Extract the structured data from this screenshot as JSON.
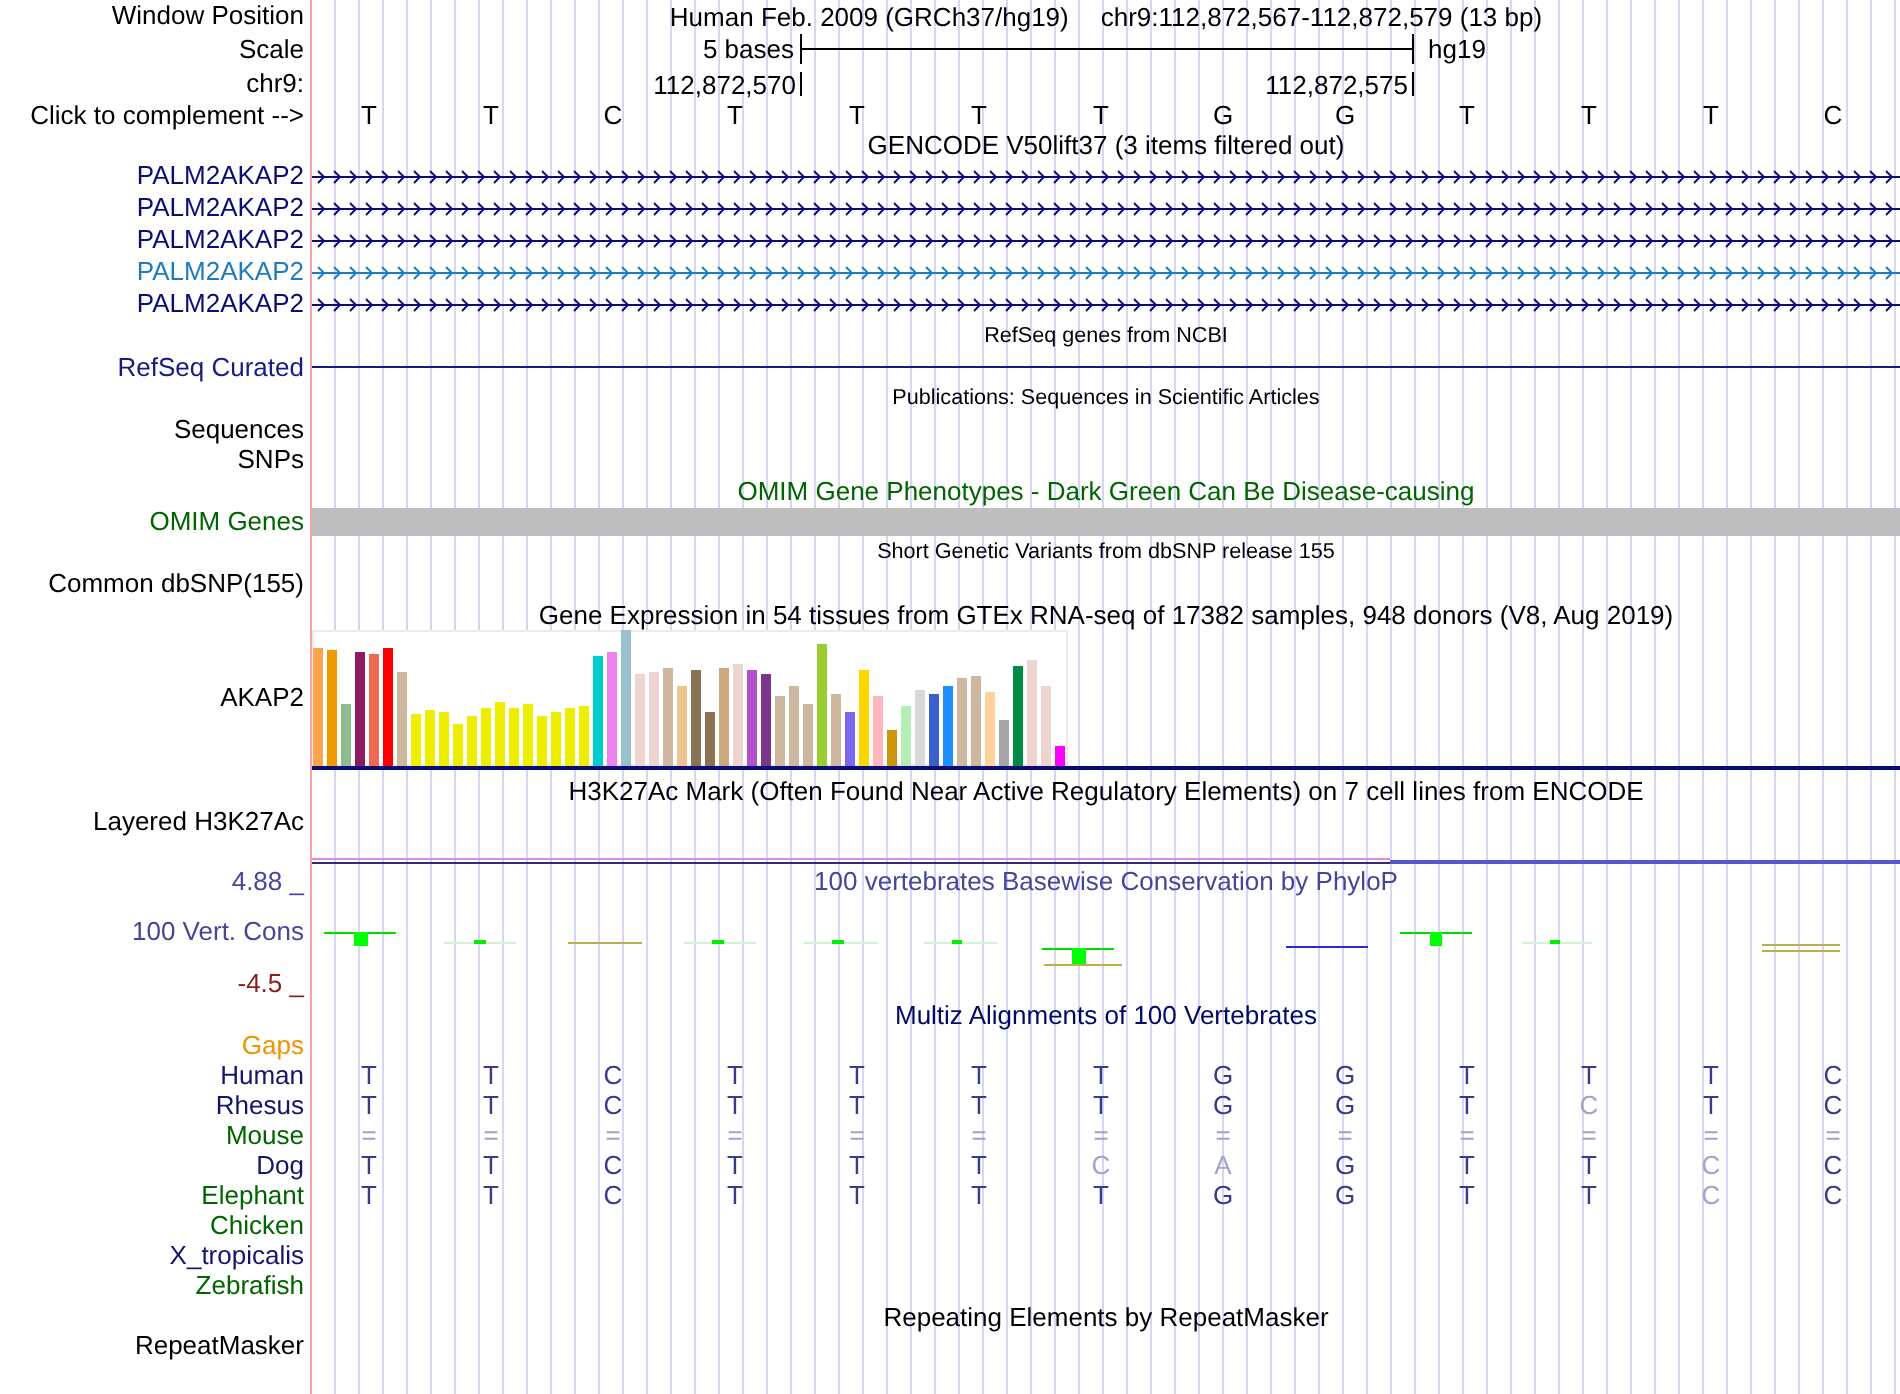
{
  "position": {
    "label": "Window Position",
    "assembly": "Human Feb. 2009 (GRCh37/hg19)",
    "range": "chr9:112,872,567-112,872,579 (13 bp)"
  },
  "scale": {
    "label": "Scale",
    "length": "5 bases",
    "database": "hg19"
  },
  "coordinates": {
    "label": "chr9:",
    "ticks": [
      "112,872,570",
      "112,872,575"
    ]
  },
  "sequence": {
    "label": "Click to complement -->",
    "bases": [
      "T",
      "T",
      "C",
      "T",
      "T",
      "T",
      "T",
      "G",
      "G",
      "T",
      "T",
      "T",
      "C"
    ]
  },
  "tracks": [
    {
      "kind": "genes",
      "title": "GENCODE V50lift37 (3 items filtered out)",
      "items": [
        {
          "label": "PALM2AKAP2",
          "color": "#0c0c78"
        },
        {
          "label": "PALM2AKAP2",
          "color": "#0c0c78"
        },
        {
          "label": "PALM2AKAP2",
          "color": "#0c0c78"
        },
        {
          "label": "PALM2AKAP2",
          "color": "#1f7bbf"
        },
        {
          "label": "PALM2AKAP2",
          "color": "#0c0c78"
        }
      ]
    },
    {
      "kind": "line",
      "title": "RefSeq genes from NCBI",
      "labels": [
        "RefSeq Curated"
      ]
    },
    {
      "kind": "empty",
      "title": "Publications: Sequences in Scientific Articles",
      "labels": [
        "Sequences",
        "SNPs"
      ]
    },
    {
      "kind": "bar",
      "title": "OMIM Gene Phenotypes - Dark Green Can Be Disease-causing",
      "labels": [
        "OMIM Genes"
      ]
    },
    {
      "kind": "empty",
      "title": "Short Genetic Variants from dbSNP release 155",
      "labels": [
        "Common dbSNP(155)"
      ]
    },
    {
      "kind": "expression",
      "title": "Gene Expression in 54 tissues from GTEx RNA-seq of 17382 samples, 948 donors (V8, Aug 2019)",
      "labels": [
        "AKAP2"
      ]
    },
    {
      "kind": "signal",
      "title": "H3K27Ac Mark (Often Found Near Active Regulatory Elements) on 7 cell lines from ENCODE",
      "labels": [
        "Layered H3K27Ac"
      ]
    },
    {
      "kind": "conservation",
      "title": "100 vertebrates Basewise Conservation by PhyloP",
      "labels": [
        "100 Vert. Cons"
      ],
      "max": "4.88 _",
      "min": "-4.5 _"
    },
    {
      "kind": "alignment",
      "title": "Multiz Alignments of 100 Vertebrates",
      "gaps": "Gaps",
      "species": [
        {
          "name": "Human",
          "color": "#14146e",
          "bases": [
            {
              "base": "T",
              "dimmed": false
            },
            {
              "base": "T",
              "dimmed": false
            },
            {
              "base": "C",
              "dimmed": false
            },
            {
              "base": "T",
              "dimmed": false
            },
            {
              "base": "T",
              "dimmed": false
            },
            {
              "base": "T",
              "dimmed": false
            },
            {
              "base": "T",
              "dimmed": false
            },
            {
              "base": "G",
              "dimmed": false
            },
            {
              "base": "G",
              "dimmed": false
            },
            {
              "base": "T",
              "dimmed": false
            },
            {
              "base": "T",
              "dimmed": false
            },
            {
              "base": "T",
              "dimmed": false
            },
            {
              "base": "C",
              "dimmed": false
            }
          ]
        },
        {
          "name": "Rhesus",
          "color": "#14146e",
          "bases": [
            {
              "base": "T",
              "dimmed": false
            },
            {
              "base": "T",
              "dimmed": false
            },
            {
              "base": "C",
              "dimmed": false
            },
            {
              "base": "T",
              "dimmed": false
            },
            {
              "base": "T",
              "dimmed": false
            },
            {
              "base": "T",
              "dimmed": false
            },
            {
              "base": "T",
              "dimmed": false
            },
            {
              "base": "G",
              "dimmed": false
            },
            {
              "base": "G",
              "dimmed": false
            },
            {
              "base": "T",
              "dimmed": false
            },
            {
              "base": "C",
              "dimmed": true
            },
            {
              "base": "T",
              "dimmed": false
            },
            {
              "base": "C",
              "dimmed": false
            }
          ]
        },
        {
          "name": "Mouse",
          "color": "#006400",
          "bases": [
            {
              "base": "=",
              "dimmed": true
            },
            {
              "base": "=",
              "dimmed": true
            },
            {
              "base": "=",
              "dimmed": true
            },
            {
              "base": "=",
              "dimmed": true
            },
            {
              "base": "=",
              "dimmed": true
            },
            {
              "base": "=",
              "dimmed": true
            },
            {
              "base": "=",
              "dimmed": true
            },
            {
              "base": "=",
              "dimmed": true
            },
            {
              "base": "=",
              "dimmed": true
            },
            {
              "base": "=",
              "dimmed": true
            },
            {
              "base": "=",
              "dimmed": true
            },
            {
              "base": "=",
              "dimmed": true
            },
            {
              "base": "=",
              "dimmed": true
            }
          ]
        },
        {
          "name": "Dog",
          "color": "#14146e",
          "bases": [
            {
              "base": "T",
              "dimmed": false
            },
            {
              "base": "T",
              "dimmed": false
            },
            {
              "base": "C",
              "dimmed": false
            },
            {
              "base": "T",
              "dimmed": false
            },
            {
              "base": "T",
              "dimmed": false
            },
            {
              "base": "T",
              "dimmed": false
            },
            {
              "base": "C",
              "dimmed": true
            },
            {
              "base": "A",
              "dimmed": true
            },
            {
              "base": "G",
              "dimmed": false
            },
            {
              "base": "T",
              "dimmed": false
            },
            {
              "base": "T",
              "dimmed": false
            },
            {
              "base": "C",
              "dimmed": true
            },
            {
              "base": "C",
              "dimmed": false
            }
          ]
        },
        {
          "name": "Elephant",
          "color": "#006400",
          "bases": [
            {
              "base": "T",
              "dimmed": false
            },
            {
              "base": "T",
              "dimmed": false
            },
            {
              "base": "C",
              "dimmed": false
            },
            {
              "base": "T",
              "dimmed": false
            },
            {
              "base": "T",
              "dimmed": false
            },
            {
              "base": "T",
              "dimmed": false
            },
            {
              "base": "T",
              "dimmed": false
            },
            {
              "base": "G",
              "dimmed": false
            },
            {
              "base": "G",
              "dimmed": false
            },
            {
              "base": "T",
              "dimmed": false
            },
            {
              "base": "T",
              "dimmed": false
            },
            {
              "base": "C",
              "dimmed": true
            },
            {
              "base": "C",
              "dimmed": false
            }
          ]
        },
        {
          "name": "Chicken",
          "color": "#006400"
        },
        {
          "name": "X_tropicalis",
          "color": "#14146e"
        },
        {
          "name": "Zebrafish",
          "color": "#006400"
        }
      ]
    },
    {
      "kind": "repeats",
      "title": "Repeating Elements by RepeatMasker",
      "labels": [
        "RepeatMasker"
      ]
    }
  ]
}
